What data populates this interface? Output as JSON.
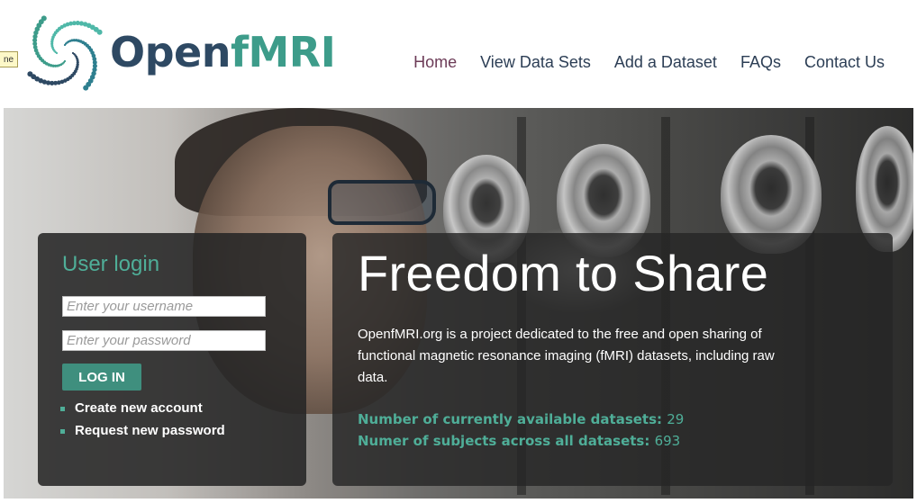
{
  "brand": {
    "part1": "Open",
    "part2": "fMRI"
  },
  "tooltip": "ne",
  "nav": {
    "items": [
      {
        "label": "Home",
        "active": true
      },
      {
        "label": "View Data Sets"
      },
      {
        "label": "Add a Dataset"
      },
      {
        "label": "FAQs"
      },
      {
        "label": "Contact Us"
      }
    ]
  },
  "login": {
    "title": "User login",
    "username_placeholder": "Enter your username",
    "password_placeholder": "Enter your password",
    "button_label": "LOG IN",
    "links": [
      "Create new account",
      "Request new password"
    ]
  },
  "intro": {
    "title": "Freedom to Share",
    "text": "OpenfMRI.org is a project dedicated to the free and open sharing of functional magnetic resonance imaging (fMRI) datasets, including raw data.",
    "stats": [
      {
        "label": "Number of currently available datasets:",
        "value": "29"
      },
      {
        "label": "Numer of subjects across all datasets:",
        "value": "693"
      }
    ]
  },
  "colors": {
    "accent": "#4fae98",
    "brand_dark": "#2e4963",
    "nav_active": "#6c3b57",
    "button": "#3f8f7e"
  }
}
